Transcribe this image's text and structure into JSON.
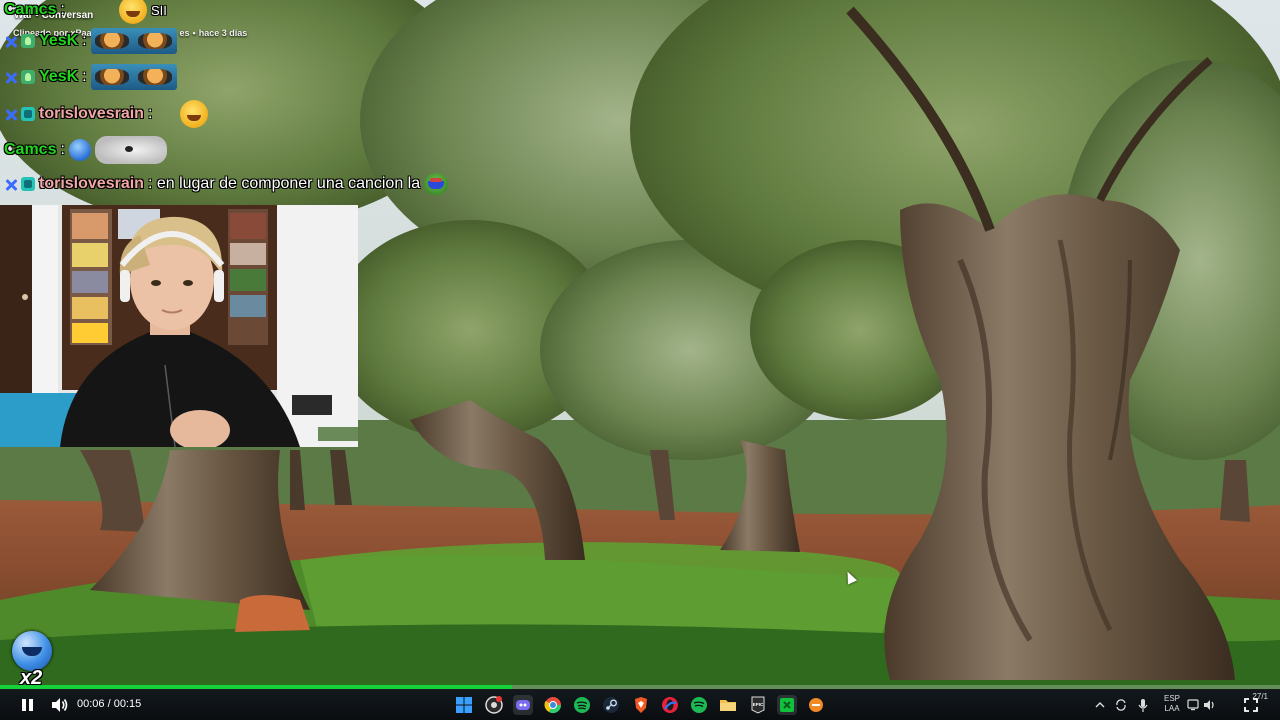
{
  "clip": {
    "title": "War • Conversan",
    "clipped_by": "Clipeado por xPaa",
    "title_tail": "es",
    "age": "hace 3 días"
  },
  "chat": [
    {
      "user": "Camcs",
      "user_color": "#22d61e",
      "badges": [],
      "message": ":",
      "emote": "smile",
      "trailing": "SII"
    },
    {
      "user": "YesK",
      "user_color": "#22d61e",
      "badges": [
        "x-badge",
        "plant-badge"
      ],
      "message": ":",
      "emote": "glasses"
    },
    {
      "user": "YesK",
      "user_color": "#22d61e",
      "badges": [
        "x-badge",
        "plant-badge"
      ],
      "message": ":",
      "emote": "glasses"
    },
    {
      "user": "torislovesrain",
      "user_color": "#f2a6a6",
      "badges": [
        "x-badge",
        "cyan-badge"
      ],
      "message": ":",
      "emote": "smile"
    },
    {
      "user": "Camcs",
      "user_color": "#22d61e",
      "badges": [],
      "message": ":",
      "emote": "seal"
    },
    {
      "user": "torislovesrain",
      "user_color": "#f2a6a6",
      "badges": [
        "x-badge",
        "cyan-badge"
      ],
      "message": ": en lugar de componer una cancion la",
      "emote": "pepe"
    }
  ],
  "speed_badge": "x2",
  "player": {
    "current_time": "00:06",
    "duration": "00:15",
    "time_display": "00:06 / 00:15",
    "progress_fraction": 0.4
  },
  "taskbar": {
    "apps": [
      "windows-start",
      "obs",
      "discord",
      "chrome",
      "spotify",
      "steam",
      "brave",
      "opera",
      "spotify-alt",
      "file-explorer",
      "epic-games",
      "green-app",
      "orange-app"
    ],
    "language": [
      "ESP",
      "LAA"
    ],
    "clock_time": "",
    "clock_date": "27/1",
    "colors": {
      "accent": "#16d23a",
      "bar": "#0e1216"
    }
  }
}
